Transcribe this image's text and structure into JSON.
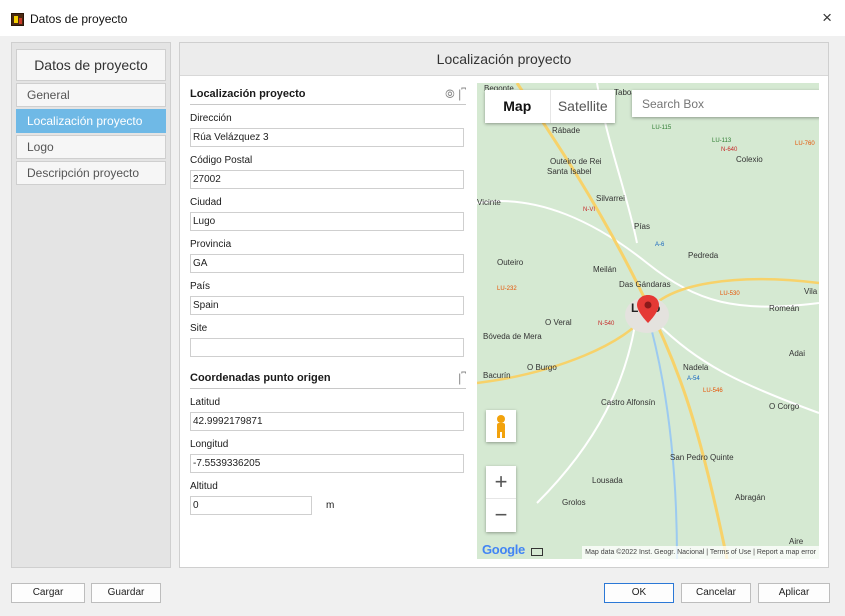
{
  "window": {
    "title": "Datos de proyecto",
    "close_glyph": "×"
  },
  "sidebar": {
    "header": "Datos de proyecto",
    "items": [
      {
        "label": "General",
        "active": false
      },
      {
        "label": "Localización proyecto",
        "active": true
      },
      {
        "label": "Logo",
        "active": false
      },
      {
        "label": "Descripción proyecto",
        "active": false
      }
    ]
  },
  "main": {
    "header": "Localización proyecto",
    "location_section": {
      "title": "Localización proyecto",
      "icons": [
        "pin-icon",
        "bracket-icon"
      ],
      "fields": [
        {
          "label": "Dirección",
          "value": "Rúa Velázquez 3"
        },
        {
          "label": "Código Postal",
          "value": "27002"
        },
        {
          "label": "Ciudad",
          "value": "Lugo"
        },
        {
          "label": "Provincia",
          "value": "GA"
        },
        {
          "label": "País",
          "value": "Spain"
        },
        {
          "label": "Site",
          "value": ""
        }
      ]
    },
    "origin_section": {
      "title": "Coordenadas punto origen",
      "icons": [
        "bracket-icon"
      ],
      "latitude_label": "Latitud",
      "latitude_value": "42.9992179871",
      "longitude_label": "Longitud",
      "longitude_value": "-7.5539336205",
      "altitude_label": "Altitud",
      "altitude_value": "0",
      "altitude_unit": "m"
    }
  },
  "map": {
    "type_map": "Map",
    "type_satellite": "Satellite",
    "search_placeholder": "Search Box",
    "zoom_in": "+",
    "zoom_out": "−",
    "logo": "Google",
    "attribution": "Map data ©2022 Inst. Geogr. Nacional  |  Terms of Use  |  Report a map error",
    "places": [
      "Begonte",
      "Taboa",
      "Rábade",
      "Outeiro de Rei",
      "Santa Isabel",
      "Colexio",
      "Silvarrei",
      "Vicinte",
      "Pías",
      "Pedreda",
      "Outeiro",
      "Meilán",
      "Das Gándaras",
      "Lugo",
      "Romeán",
      "O Veral",
      "Bóveda de Mera",
      "Bacurín",
      "O Burgo",
      "Nadela",
      "Adai",
      "Castro Alfonsín",
      "O Corgo",
      "San Pedro Quinte",
      "Lousada",
      "Abragán",
      "Grolos",
      "Vila",
      "Aire"
    ],
    "road_labels": [
      "LU-115",
      "LU-113",
      "N-640",
      "LU-760",
      "A-6",
      "N-VI",
      "LU-232",
      "LU-530",
      "N-540",
      "A-54",
      "LU-546"
    ],
    "marker_color": "#e53935"
  },
  "buttons": {
    "cargar": "Cargar",
    "guardar": "Guardar",
    "ok": "OK",
    "cancelar": "Cancelar",
    "aplicar": "Aplicar"
  },
  "colors": {
    "accent": "#6fb9e6",
    "primary_border": "#2b78d6"
  }
}
